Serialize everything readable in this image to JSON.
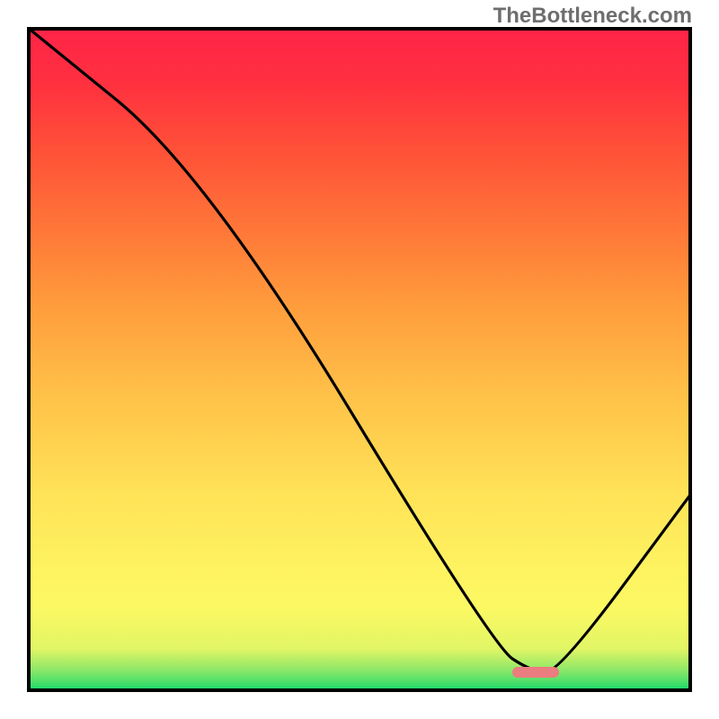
{
  "watermark": "TheBottleneck.com",
  "chart_data": {
    "type": "line",
    "title": "",
    "xlabel": "",
    "ylabel": "",
    "xlim": [
      0,
      100
    ],
    "ylim": [
      0,
      100
    ],
    "grid": false,
    "legend": false,
    "series": [
      {
        "name": "bottleneck-curve",
        "x": [
          0,
          27,
          70,
          76,
          80,
          100
        ],
        "values": [
          100,
          78,
          7,
          3,
          3,
          30
        ]
      }
    ],
    "marker": {
      "name": "optimal-range",
      "x_start": 73,
      "x_end": 80,
      "y": 3
    },
    "background_gradient_stops": [
      {
        "pos": 0.0,
        "color": "#21da6b"
      },
      {
        "pos": 0.01,
        "color": "#4de06a"
      },
      {
        "pos": 0.03,
        "color": "#93e868"
      },
      {
        "pos": 0.06,
        "color": "#e1f565"
      },
      {
        "pos": 0.12,
        "color": "#fbf963"
      },
      {
        "pos": 0.18,
        "color": "#fef360"
      },
      {
        "pos": 0.3,
        "color": "#ffe257"
      },
      {
        "pos": 0.45,
        "color": "#ffc048"
      },
      {
        "pos": 0.58,
        "color": "#ff9d3c"
      },
      {
        "pos": 0.7,
        "color": "#ff7638"
      },
      {
        "pos": 0.82,
        "color": "#ff5038"
      },
      {
        "pos": 0.92,
        "color": "#ff303f"
      },
      {
        "pos": 1.0,
        "color": "#ff2448"
      }
    ]
  }
}
